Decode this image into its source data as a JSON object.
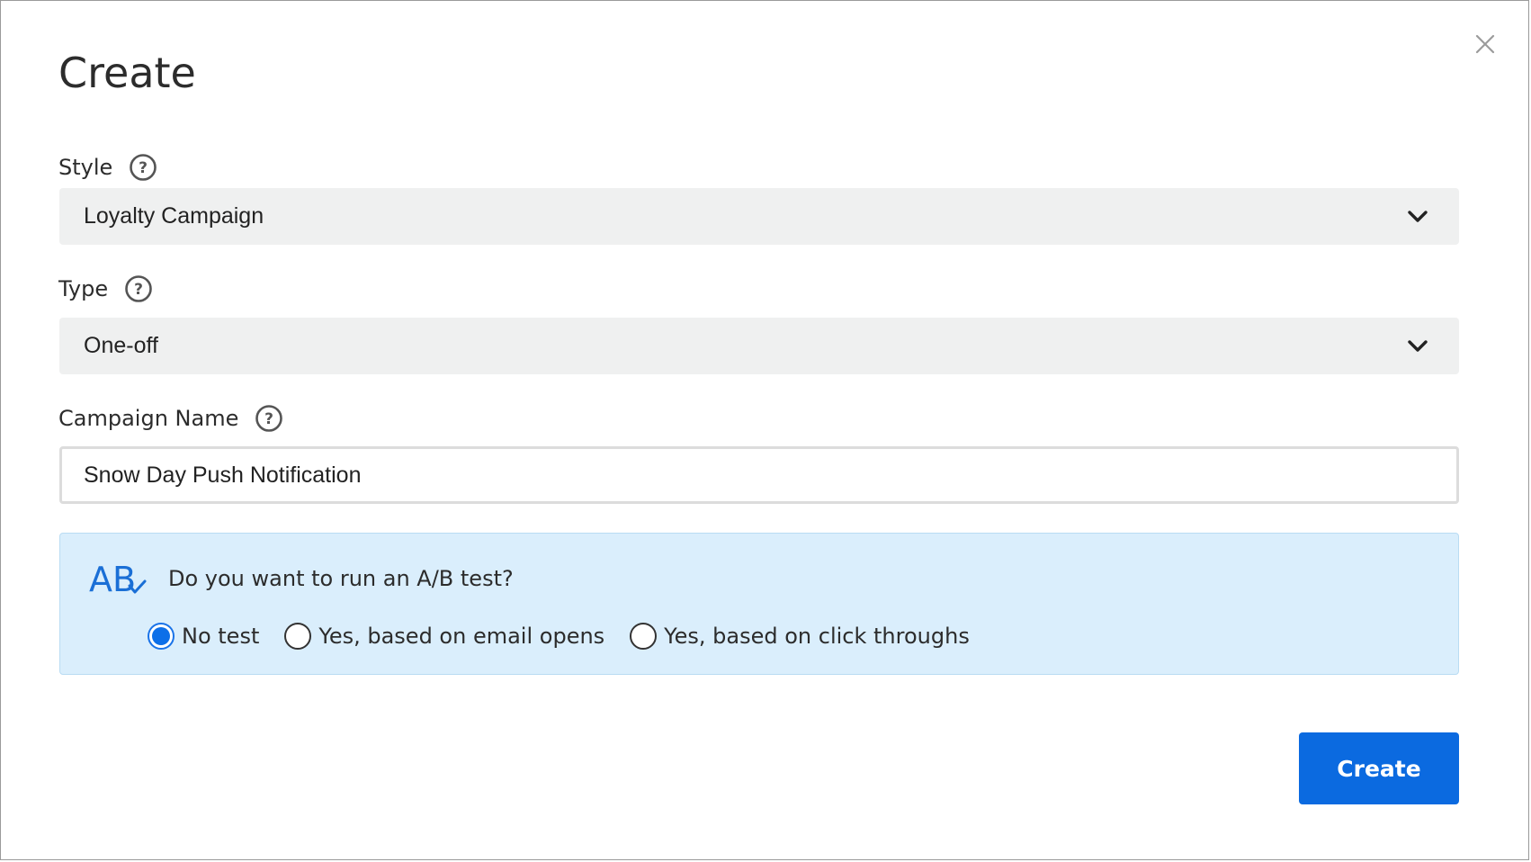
{
  "dialog": {
    "title": "Create",
    "close_label": "×"
  },
  "style_field": {
    "label": "Style",
    "value": "Loyalty Campaign"
  },
  "type_field": {
    "label": "Type",
    "value": "One-off"
  },
  "campaign_name_field": {
    "label": "Campaign Name",
    "value": "Snow Day Push Notification"
  },
  "ab_test": {
    "question": "Do you want to run an A/B test?",
    "options": [
      {
        "label": "No test",
        "selected": true
      },
      {
        "label": "Yes, based on email opens",
        "selected": false
      },
      {
        "label": "Yes, based on click throughs",
        "selected": false
      }
    ]
  },
  "actions": {
    "create_label": "Create"
  },
  "colors": {
    "primary": "#0b6ae0",
    "panel_bg": "#daeefc",
    "select_bg": "#eff0f0"
  },
  "icons": {
    "close": "close-icon",
    "help": "help-circle-icon",
    "chevron": "chevron-down-icon",
    "ab": "ab-test-icon"
  }
}
